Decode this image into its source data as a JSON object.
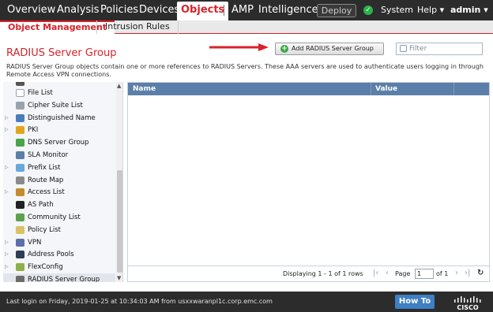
{
  "topnav": {
    "items": [
      "Overview",
      "Analysis",
      "Policies",
      "Devices",
      "Objects",
      "AMP",
      "Intelligence"
    ],
    "active": "Objects",
    "deploy_label": "Deploy",
    "system_label": "System",
    "help_label": "Help ▾",
    "user_label": "admin ▾"
  },
  "subnav": {
    "tabs": [
      "Object Management",
      "Intrusion Rules"
    ]
  },
  "page": {
    "title": "RADIUS Server Group",
    "description_line1": "RADIUS Server Group objects contain one or more references to RADIUS Servers. These AAA servers are used to authenticate users logging in through",
    "description_line2": "Remote Access VPN connections.",
    "add_button_label": "Add RADIUS Server Group",
    "filter_placeholder": "Filter"
  },
  "sidebar": {
    "items": [
      {
        "label": "File List",
        "icon": "file-list-icon",
        "color": "#ffffff",
        "expandable": false
      },
      {
        "label": "Cipher Suite List",
        "icon": "cipher-suite-icon",
        "color": "#9aa3ad",
        "expandable": false
      },
      {
        "label": "Distinguished Name",
        "icon": "distinguished-name-icon",
        "color": "#4a7ebb",
        "expandable": true
      },
      {
        "label": "PKI",
        "icon": "pki-key-icon",
        "color": "#e2a61d",
        "expandable": true
      },
      {
        "label": "DNS Server Group",
        "icon": "dns-server-icon",
        "color": "#4aa34d",
        "expandable": false
      },
      {
        "label": "SLA Monitor",
        "icon": "sla-monitor-icon",
        "color": "#5b7fa8",
        "expandable": false
      },
      {
        "label": "Prefix List",
        "icon": "prefix-list-icon",
        "color": "#6aa8d8",
        "expandable": true
      },
      {
        "label": "Route Map",
        "icon": "route-map-icon",
        "color": "#8a8a8a",
        "expandable": false
      },
      {
        "label": "Access List",
        "icon": "access-list-icon",
        "color": "#c58b2c",
        "expandable": true
      },
      {
        "label": "AS Path",
        "icon": "as-path-icon",
        "color": "#222222",
        "expandable": false
      },
      {
        "label": "Community List",
        "icon": "community-list-icon",
        "color": "#5fa050",
        "expandable": false
      },
      {
        "label": "Policy List",
        "icon": "policy-list-icon",
        "color": "#d9c26a",
        "expandable": false
      },
      {
        "label": "VPN",
        "icon": "vpn-icon",
        "color": "#5b6fa8",
        "expandable": true
      },
      {
        "label": "Address Pools",
        "icon": "address-pools-icon",
        "color": "#2f3e55",
        "expandable": true
      },
      {
        "label": "FlexConfig",
        "icon": "flexconfig-icon",
        "color": "#8cb04a",
        "expandable": true
      },
      {
        "label": "RADIUS Server Group",
        "icon": "radius-server-group-icon",
        "color": "#6b6b6b",
        "expandable": false,
        "selected": true
      }
    ]
  },
  "table": {
    "columns": [
      "Name",
      "Value"
    ],
    "rows": [],
    "pager": {
      "displaying": "Displaying 1 - 1 of 1 rows",
      "page_label": "Page",
      "page_value": "1",
      "of_label": "of 1"
    }
  },
  "footer": {
    "login_text": "Last login on Friday, 2019-01-25 at 10:34:03 AM from usxxwaranpl1c.corp.emc.com",
    "howto_label": "How To"
  },
  "colors": {
    "accent": "#d8232a",
    "nav_bg": "#2c2c2c",
    "table_header": "#5b7fa8",
    "howto_blue": "#3f7fc4",
    "status_green": "#2bb24c"
  }
}
